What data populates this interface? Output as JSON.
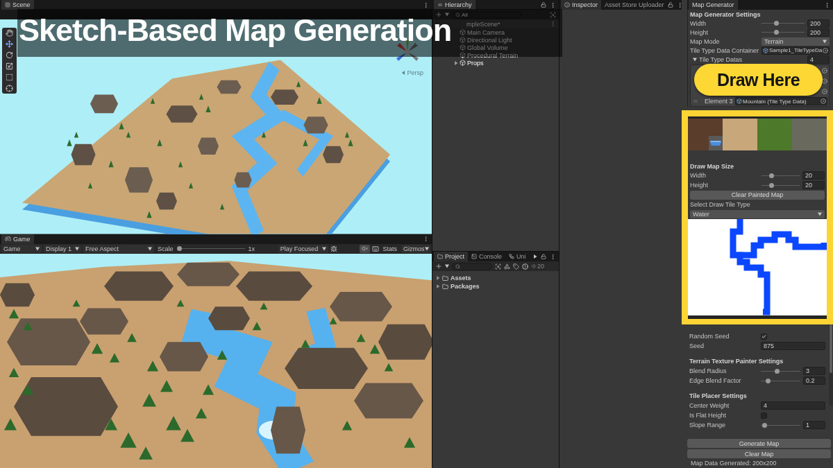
{
  "title_banner": {
    "text": "Sketch-Based Map Generation"
  },
  "callout": {
    "text": "Draw Here"
  },
  "scene_view": {
    "tab": {
      "label": "Scene",
      "selected": true
    },
    "camera_label": "Persp"
  },
  "game_view": {
    "tab": {
      "label": "Game",
      "selected": true
    },
    "toolbar": {
      "view": "Game",
      "display": "Display 1",
      "aspect": "Free Aspect",
      "scale": {
        "label": "Scale",
        "level": 0,
        "value": "1x"
      },
      "play_mode": "Play Focused",
      "audio_muted": true,
      "stats": "Stats",
      "gizmos": "Gizmos"
    }
  },
  "hierarchy": {
    "tab": {
      "label": "Hierarchy",
      "selected": true
    },
    "search_placeholder": "All",
    "scene": "mpleScene*",
    "items": [
      {
        "kind": "object",
        "name": "Main Camera"
      },
      {
        "kind": "object",
        "name": "Directional Light"
      },
      {
        "kind": "object",
        "name": "Global Volume"
      },
      {
        "kind": "object",
        "name": "Procedural Terrain"
      },
      {
        "kind": "group",
        "name": "Props",
        "expanded": false
      }
    ]
  },
  "project": {
    "tabs": [
      {
        "label": "Project",
        "selected": true
      },
      {
        "label": "Console",
        "selected": false
      },
      {
        "label": "Uni",
        "selected": false
      }
    ],
    "visible_count": "20",
    "folders": [
      {
        "name": "Assets",
        "expanded": false
      },
      {
        "name": "Packages",
        "expanded": false
      }
    ]
  },
  "inspector": {
    "tabs": [
      {
        "label": "Inspector",
        "selected": true
      },
      {
        "label": "Asset Store Uploader",
        "selected": false
      }
    ]
  },
  "map_generator": {
    "tab": {
      "label": "Map Generator",
      "selected": true
    },
    "settings": [
      {
        "kind": "heading",
        "label": "Map Generator Settings"
      },
      {
        "kind": "slider",
        "label": "Width",
        "level": 0.33,
        "value": "200"
      },
      {
        "kind": "slider",
        "label": "Height",
        "level": 0.33,
        "value": "200"
      },
      {
        "kind": "dropdown",
        "label": "Map Mode",
        "value": "Terrain"
      },
      {
        "kind": "object",
        "label": "Tile Type Data Container",
        "value": "Sample1_TileTypeDa"
      }
    ],
    "tile_type_datas": {
      "label": "Tile Type Datas",
      "expanded": true,
      "count": "4",
      "elements": [
        {
          "kind": "covered"
        },
        {
          "kind": "covered"
        },
        {
          "kind": "covered"
        },
        {
          "kind": "visible",
          "label": "Element 3",
          "value": "Mountain (Tile Type Data)"
        }
      ]
    },
    "draw_panel": {
      "textures": [
        {
          "color": "#5b3d2c",
          "badge": true
        },
        {
          "color": "#c8a77a",
          "badge": false
        },
        {
          "color": "#4d7a2a",
          "badge": false
        },
        {
          "color": "#6a695d",
          "badge": false
        }
      ],
      "title": "Draw Map Size",
      "rows": [
        {
          "kind": "slider",
          "label": "Width",
          "level": 0.22,
          "value": "20"
        },
        {
          "kind": "slider",
          "label": "Height",
          "level": 0.22,
          "value": "20"
        },
        {
          "kind": "button",
          "label": "Clear Painted Map"
        },
        {
          "kind": "label",
          "label": "Select Draw Tile Type"
        },
        {
          "kind": "dropdown",
          "value": "Water"
        }
      ]
    },
    "more_settings": [
      {
        "kind": "checkbox",
        "label": "Random Seed",
        "checked": true
      },
      {
        "kind": "field",
        "label": "Seed",
        "value": "875"
      },
      {
        "kind": "heading",
        "label": "Terrain Texture Painter Settings"
      },
      {
        "kind": "slider",
        "label": "Blend Radius",
        "level": 0.39,
        "value": "3"
      },
      {
        "kind": "slider",
        "label": "Edge Blend Factor",
        "level": 0.13,
        "value": "0.2"
      },
      {
        "kind": "heading",
        "label": "Tile Placer Settings"
      },
      {
        "kind": "field",
        "label": "Center Weight",
        "value": "4"
      },
      {
        "kind": "checkbox",
        "label": "Is Flat Height",
        "checked": false
      },
      {
        "kind": "slider",
        "label": "Slope Range",
        "level": 0.04,
        "value": "1"
      }
    ],
    "actions": [
      "Generate Map",
      "Clear Map"
    ],
    "status": "Map Data Generated: 200x200"
  }
}
